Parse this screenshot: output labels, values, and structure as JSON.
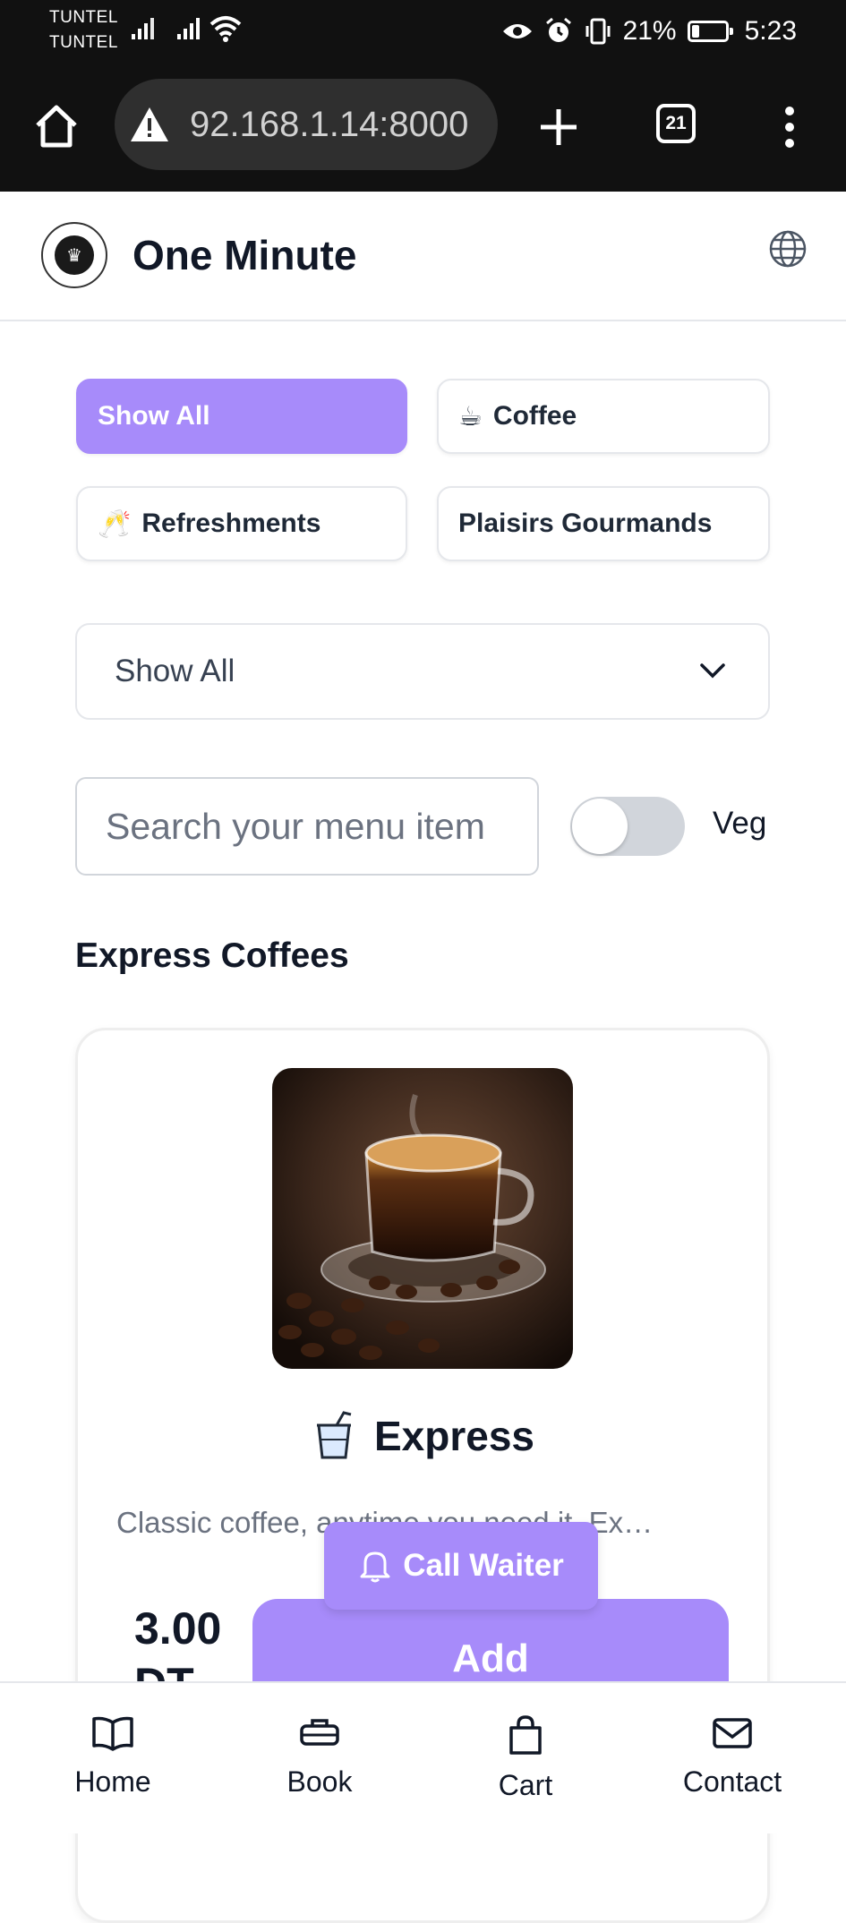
{
  "status_bar": {
    "carrier1": "TUNTEL",
    "carrier2": "TUNTEL",
    "battery_text": "21%",
    "battery_level": 0.21,
    "time": "5:23",
    "icons": [
      "signal-icon",
      "signal-icon",
      "wifi-icon",
      "eye-icon",
      "alarm-icon",
      "vibrate-icon",
      "battery-icon"
    ]
  },
  "browser": {
    "url": "92.168.1.14:8000",
    "tab_count": "21",
    "icons": [
      "home-icon",
      "warning-icon",
      "plus-icon",
      "tabs-icon",
      "more-icon"
    ]
  },
  "header": {
    "title": "One Minute",
    "icons": [
      "logo",
      "globe-icon"
    ]
  },
  "filters": {
    "chips": [
      {
        "label": "Show All",
        "emoji": "",
        "active": true
      },
      {
        "label": "Coffee",
        "emoji": "☕",
        "active": false
      },
      {
        "label": "Refreshments",
        "emoji": "🥂",
        "active": false
      },
      {
        "label": "Plaisirs Gourmands",
        "emoji": "",
        "active": false
      }
    ],
    "select_value": "Show All",
    "search_placeholder": "Search your menu item",
    "veg_label": "Veg",
    "veg_on": false
  },
  "section": {
    "title": "Express Coffees"
  },
  "item": {
    "name": "Express",
    "description": "Classic coffee, anytime you need it. Ex…",
    "price_line1": "3.00",
    "price_line2": "DT",
    "add_label": "Add"
  },
  "call_waiter": {
    "label": "Call Waiter"
  },
  "bottom_nav": {
    "items": [
      {
        "label": "Home",
        "icon": "book-open-icon"
      },
      {
        "label": "Book",
        "icon": "briefcase-icon"
      },
      {
        "label": "Cart",
        "icon": "shopping-bag-icon"
      },
      {
        "label": "Contact",
        "icon": "mail-icon"
      }
    ]
  },
  "colors": {
    "accent": "#a78bfa",
    "text": "#111827",
    "muted": "#6b7280",
    "border": "#e5e7eb",
    "browser_bg": "#111111"
  }
}
